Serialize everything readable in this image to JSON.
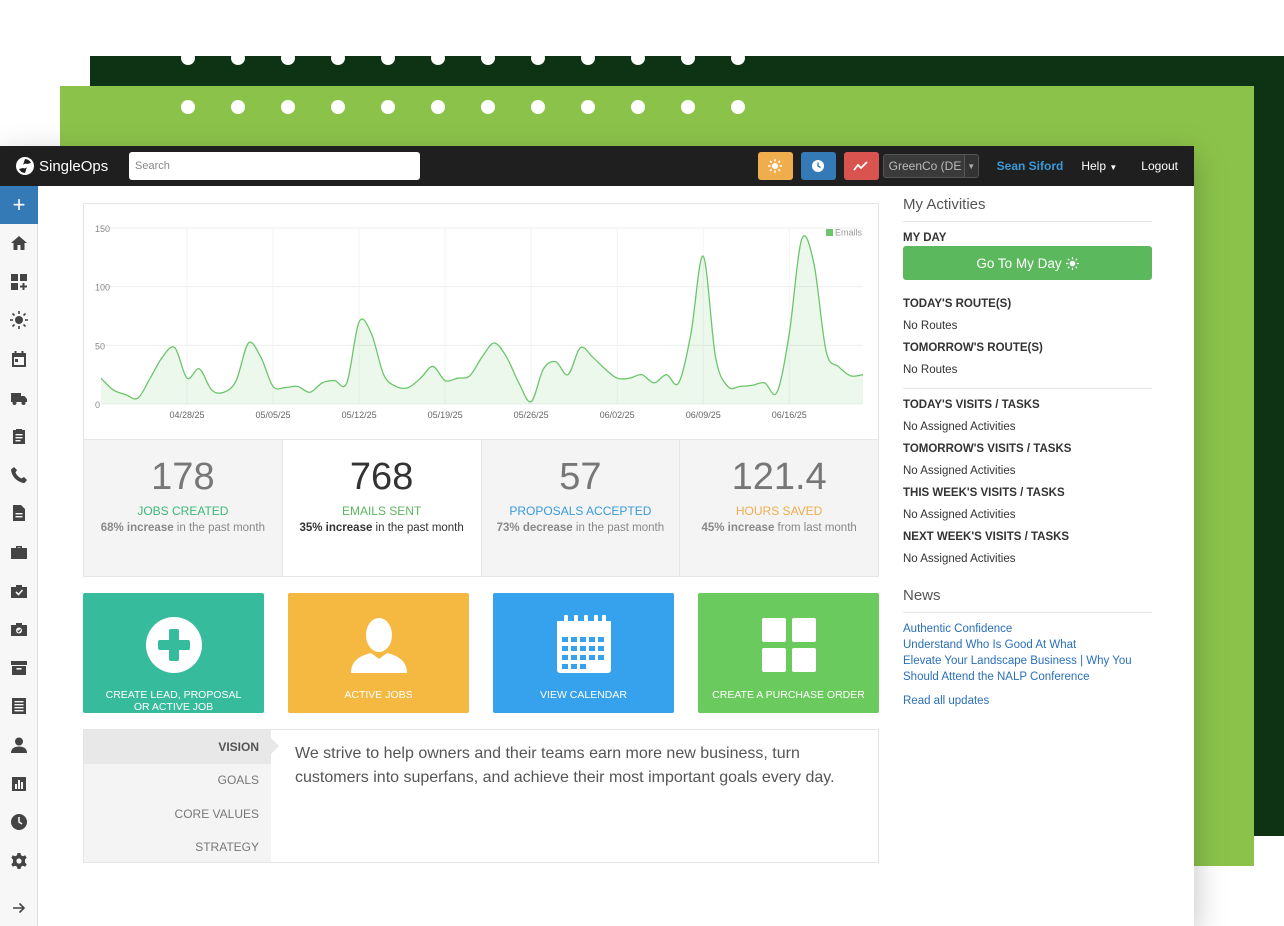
{
  "topbar": {
    "logo_text": "SingleOps",
    "search_placeholder": "Search",
    "company": "GreenCo (DE",
    "user": "Sean Siford",
    "help": "Help",
    "logout": "Logout"
  },
  "chart_data": {
    "type": "area",
    "series": [
      {
        "name": "Emails",
        "color": "#6bc66b"
      }
    ],
    "yticks": [
      "0",
      "50",
      "100",
      "150"
    ],
    "xticks": [
      "04/28/25",
      "05/05/25",
      "05/12/25",
      "05/19/25",
      "05/26/25",
      "06/02/25",
      "06/09/25",
      "06/16/25"
    ],
    "ylim": [
      0,
      150
    ],
    "x_start": "04/21/25",
    "points": [
      {
        "x": "04/21/25",
        "y": 22
      },
      {
        "x": "04/22/25",
        "y": 12
      },
      {
        "x": "04/23/25",
        "y": 8
      },
      {
        "x": "04/24/25",
        "y": 5
      },
      {
        "x": "04/25/25",
        "y": 22
      },
      {
        "x": "04/26/25",
        "y": 40
      },
      {
        "x": "04/27/25",
        "y": 48
      },
      {
        "x": "04/28/25",
        "y": 22
      },
      {
        "x": "04/29/25",
        "y": 30
      },
      {
        "x": "04/30/25",
        "y": 12
      },
      {
        "x": "05/01/25",
        "y": 10
      },
      {
        "x": "05/02/25",
        "y": 20
      },
      {
        "x": "05/03/25",
        "y": 52
      },
      {
        "x": "05/04/25",
        "y": 40
      },
      {
        "x": "05/05/25",
        "y": 15
      },
      {
        "x": "05/06/25",
        "y": 14
      },
      {
        "x": "05/07/25",
        "y": 15
      },
      {
        "x": "05/08/25",
        "y": 10
      },
      {
        "x": "05/09/25",
        "y": 18
      },
      {
        "x": "05/10/25",
        "y": 20
      },
      {
        "x": "05/11/25",
        "y": 18
      },
      {
        "x": "05/12/25",
        "y": 70
      },
      {
        "x": "05/13/25",
        "y": 60
      },
      {
        "x": "05/14/25",
        "y": 25
      },
      {
        "x": "05/15/25",
        "y": 15
      },
      {
        "x": "05/16/25",
        "y": 14
      },
      {
        "x": "05/17/25",
        "y": 22
      },
      {
        "x": "05/18/25",
        "y": 32
      },
      {
        "x": "05/19/25",
        "y": 20
      },
      {
        "x": "05/20/25",
        "y": 22
      },
      {
        "x": "05/21/25",
        "y": 24
      },
      {
        "x": "05/22/25",
        "y": 40
      },
      {
        "x": "05/23/25",
        "y": 52
      },
      {
        "x": "05/24/25",
        "y": 40
      },
      {
        "x": "05/25/25",
        "y": 18
      },
      {
        "x": "05/26/25",
        "y": 2
      },
      {
        "x": "05/27/25",
        "y": 30
      },
      {
        "x": "05/28/25",
        "y": 36
      },
      {
        "x": "05/29/25",
        "y": 25
      },
      {
        "x": "05/30/25",
        "y": 48
      },
      {
        "x": "05/31/25",
        "y": 40
      },
      {
        "x": "06/01/25",
        "y": 30
      },
      {
        "x": "06/02/25",
        "y": 22
      },
      {
        "x": "06/03/25",
        "y": 22
      },
      {
        "x": "06/04/25",
        "y": 25
      },
      {
        "x": "06/05/25",
        "y": 18
      },
      {
        "x": "06/06/25",
        "y": 25
      },
      {
        "x": "06/07/25",
        "y": 18
      },
      {
        "x": "06/08/25",
        "y": 60
      },
      {
        "x": "06/09/25",
        "y": 126
      },
      {
        "x": "06/10/25",
        "y": 40
      },
      {
        "x": "06/11/25",
        "y": 15
      },
      {
        "x": "06/12/25",
        "y": 15
      },
      {
        "x": "06/13/25",
        "y": 16
      },
      {
        "x": "06/14/25",
        "y": 18
      },
      {
        "x": "06/15/25",
        "y": 10
      },
      {
        "x": "06/16/25",
        "y": 60
      },
      {
        "x": "06/17/25",
        "y": 140
      },
      {
        "x": "06/18/25",
        "y": 120
      },
      {
        "x": "06/19/25",
        "y": 45
      },
      {
        "x": "06/20/25",
        "y": 32
      },
      {
        "x": "06/21/25",
        "y": 24
      },
      {
        "x": "06/22/25",
        "y": 25
      }
    ]
  },
  "stats": [
    {
      "value": "178",
      "label": "JOBS CREATED",
      "color": "#3cb878",
      "bold": "68% increase",
      "rest": " in the past month"
    },
    {
      "value": "768",
      "label": "EMAILS SENT",
      "color": "#5cb85c",
      "bold": "35% increase",
      "rest": " in the past month"
    },
    {
      "value": "57",
      "label": "PROPOSALS ACCEPTED",
      "color": "#3a9ad9",
      "bold": "73% decrease",
      "rest": " in the past month"
    },
    {
      "value": "121.4",
      "label": "HOURS SAVED",
      "color": "#f0ad4e",
      "bold": "45% increase",
      "rest": " from last month"
    }
  ],
  "tiles": [
    {
      "label": "CREATE LEAD, PROPOSAL OR ACTIVE JOB",
      "color": "#36bb9c",
      "icon": "plus-circle-icon"
    },
    {
      "label": "ACTIVE JOBS",
      "color": "#f5b942",
      "icon": "person-icon"
    },
    {
      "label": "VIEW CALENDAR",
      "color": "#36a2ee",
      "icon": "calendar-icon"
    },
    {
      "label": "CREATE A PURCHASE ORDER",
      "color": "#6bca5e",
      "icon": "grid-icon"
    }
  ],
  "vision": {
    "tabs": [
      "VISION",
      "GOALS",
      "CORE VALUES",
      "STRATEGY"
    ],
    "text": "We strive to help owners and their teams earn more new business, turn customers into superfans, and achieve their most important goals every day."
  },
  "activities": {
    "title": "My Activities",
    "my_day": "MY DAY",
    "my_day_button": "Go To My Day",
    "todays_routes": "TODAY'S ROUTE(S)",
    "todays_routes_value": "No Routes",
    "tomorrows_routes": "TOMORROW'S ROUTE(S)",
    "tomorrows_routes_value": "No Routes",
    "todays_visits": "TODAY'S VISITS / TASKS",
    "todays_visits_value": "No Assigned Activities",
    "tomorrows_visits": "TOMORROW'S VISITS / TASKS",
    "tomorrows_visits_value": "No Assigned Activities",
    "this_week": "THIS WEEK'S VISITS / TASKS",
    "this_week_value": "No Assigned Activities",
    "next_week": "NEXT WEEK'S VISITS / TASKS",
    "next_week_value": "No Assigned Activities"
  },
  "news": {
    "title": "News",
    "items": [
      "Authentic Confidence",
      "Understand Who Is Good At What",
      "Elevate Your Landscape Business | Why You Should Attend the NALP Conference"
    ],
    "read_all": "Read all updates"
  },
  "sidebar": {
    "items": [
      "home-icon",
      "dashboard-add-icon",
      "sun-icon",
      "calendar-icon",
      "truck-icon",
      "clipboard-icon",
      "phone-icon",
      "document-icon",
      "briefcase-icon",
      "check-briefcase-icon",
      "check-briefcase-alt-icon",
      "archive-icon",
      "list-icon",
      "person-icon",
      "chart-icon",
      "clock-icon",
      "gear-icon"
    ]
  }
}
